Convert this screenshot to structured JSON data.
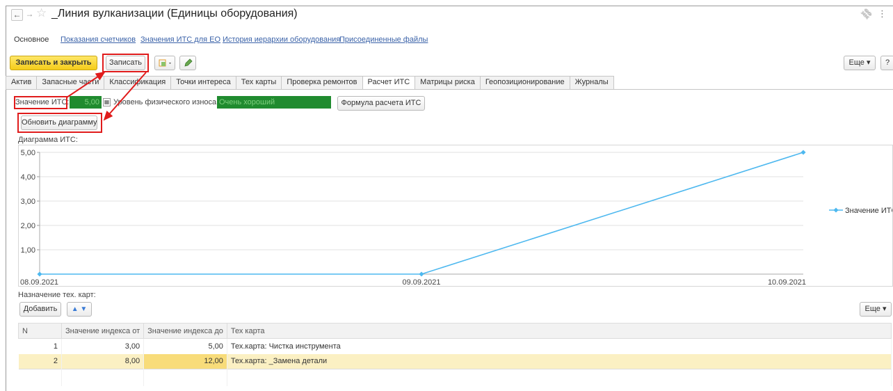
{
  "window": {
    "title": "_Линия вулканизации (Единицы оборудования)",
    "back_icon": "←",
    "forward_icon": "→",
    "star_icon": "☆",
    "link_icon": "⛓",
    "more_icon": "⋮"
  },
  "sections": [
    "Основное",
    "Показания счетчиков",
    "Значения ИТС для ЕО",
    "История иерархии оборудования",
    "Присоединенные файлы"
  ],
  "toolbar": {
    "save_close_label": "Записать и закрыть",
    "save_label": "Записать",
    "more_label": "Еще",
    "help_label": "?"
  },
  "tabs": [
    "Актив",
    "Запасные части",
    "Классификация",
    "Точки интереса",
    "Тех карты",
    "Проверка ремонтов",
    "Расчет ИТС",
    "Матрицы риска",
    "Геопозиционирование",
    "Журналы"
  ],
  "form": {
    "its_label": "Значение ИТС:",
    "its_value": "5,00",
    "wear_label": "Уровень физического износа:",
    "wear_value": "Очень хороший",
    "formula_button": "Формула расчета ИТС",
    "refresh_button": "Обновить диаграмму",
    "chart_caption": "Диаграмма ИТС:"
  },
  "chart_data": {
    "type": "line",
    "x": [
      "08.09.2021",
      "09.09.2021",
      "10.09.2021"
    ],
    "series": [
      {
        "name": "Значение ИТС",
        "values": [
          0,
          0,
          5
        ]
      }
    ],
    "y_ticks": [
      "5,00",
      "4,00",
      "3,00",
      "2,00",
      "1,00"
    ],
    "ylim": [
      0,
      5
    ],
    "grid": true,
    "legend": "right",
    "color": "#4db8ef"
  },
  "techcards": {
    "caption": "Назначение тех. карт:",
    "add_label": "Добавить",
    "up_icon": "▲",
    "down_icon": "▼",
    "more_label": "Еще",
    "columns": [
      "N",
      "Значение индекса от",
      "Значение индекса до",
      "Тех карта"
    ],
    "rows": [
      {
        "n": "1",
        "from": "3,00",
        "to": "5,00",
        "card": "Тех.карта: Чистка инструмента"
      },
      {
        "n": "2",
        "from": "8,00",
        "to": "12,00",
        "card": "Тех.карта: _Замена детали"
      }
    ]
  }
}
